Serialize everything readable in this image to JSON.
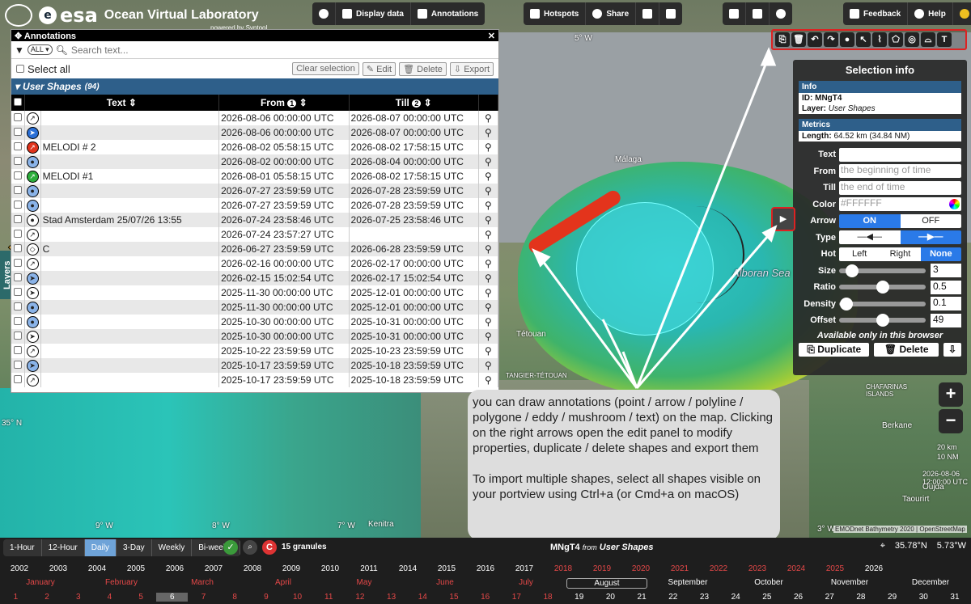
{
  "topbar": {
    "brand": "esa",
    "title": "Ocean Virtual Laboratory",
    "powered": "powered by Syntool",
    "display_data": "Display data",
    "annotations": "Annotations",
    "hotspots": "Hotspots",
    "share": "Share",
    "feedback": "Feedback",
    "help": "Help"
  },
  "annotations_panel": {
    "title": "Annotations",
    "filter": "ALL",
    "search_placeholder": "Search text...",
    "select_all": "Select all",
    "clear_selection": "Clear selection",
    "edit": "Edit",
    "delete": "Delete",
    "export": "Export",
    "group_name": "User Shapes",
    "group_count": "(94)",
    "columns": {
      "text": "Text",
      "from": "From",
      "till": "Till",
      "from_sort": "1",
      "till_sort": "2"
    },
    "rows": [
      {
        "icon": "polyline-icon",
        "style": "",
        "text": "",
        "from": "2026-08-06 00:00:00 UTC",
        "till": "2026-08-07 00:00:00 UTC"
      },
      {
        "icon": "arrow-icon",
        "style": "blue",
        "text": "",
        "from": "2026-08-06 00:00:00 UTC",
        "till": "2026-08-07 00:00:00 UTC"
      },
      {
        "icon": "polyline-icon",
        "style": "red",
        "text": "MELODI # 2",
        "from": "2026-08-02 05:58:15 UTC",
        "till": "2026-08-02 17:58:15 UTC"
      },
      {
        "icon": "point-icon",
        "style": "lblue",
        "text": "",
        "from": "2026-08-02 00:00:00 UTC",
        "till": "2026-08-04 00:00:00 UTC"
      },
      {
        "icon": "polyline-icon",
        "style": "green",
        "text": "MELODI #1",
        "from": "2026-08-01 05:58:15 UTC",
        "till": "2026-08-02 17:58:15 UTC"
      },
      {
        "icon": "point-icon",
        "style": "lblue",
        "text": "",
        "from": "2026-07-27 23:59:59 UTC",
        "till": "2026-07-28 23:59:59 UTC"
      },
      {
        "icon": "point-icon",
        "style": "lblue",
        "text": "",
        "from": "2026-07-27 23:59:59 UTC",
        "till": "2026-07-28 23:59:59 UTC"
      },
      {
        "icon": "point-icon",
        "style": "",
        "text": "Stad Amsterdam 25/07/26 13:55",
        "from": "2026-07-24 23:58:46 UTC",
        "till": "2026-07-25 23:58:46 UTC"
      },
      {
        "icon": "polyline-icon",
        "style": "",
        "text": "",
        "from": "2026-07-24 23:57:27 UTC",
        "till": ""
      },
      {
        "icon": "polygon-icon",
        "style": "",
        "text": "C",
        "from": "2026-06-27 23:59:59 UTC",
        "till": "2026-06-28 23:59:59 UTC"
      },
      {
        "icon": "polyline-icon",
        "style": "",
        "text": "",
        "from": "2026-02-16 00:00:00 UTC",
        "till": "2026-02-17 00:00:00 UTC"
      },
      {
        "icon": "arrow-icon",
        "style": "lblue",
        "text": "",
        "from": "2026-02-15 15:02:54 UTC",
        "till": "2026-02-17 15:02:54 UTC"
      },
      {
        "icon": "arrow-icon",
        "style": "",
        "text": "",
        "from": "2025-11-30 00:00:00 UTC",
        "till": "2025-12-01 00:00:00 UTC"
      },
      {
        "icon": "point-icon",
        "style": "lblue",
        "text": "",
        "from": "2025-11-30 00:00:00 UTC",
        "till": "2025-12-01 00:00:00 UTC"
      },
      {
        "icon": "point-icon",
        "style": "lblue",
        "text": "",
        "from": "2025-10-30 00:00:00 UTC",
        "till": "2025-10-31 00:00:00 UTC"
      },
      {
        "icon": "arrow-icon",
        "style": "",
        "text": "",
        "from": "2025-10-30 00:00:00 UTC",
        "till": "2025-10-31 00:00:00 UTC"
      },
      {
        "icon": "polyline-icon",
        "style": "",
        "text": "",
        "from": "2025-10-22 23:59:59 UTC",
        "till": "2025-10-23 23:59:59 UTC"
      },
      {
        "icon": "arrow-icon",
        "style": "lblue",
        "text": "",
        "from": "2025-10-17 23:59:59 UTC",
        "till": "2025-10-18 23:59:59 UTC"
      },
      {
        "icon": "polyline-icon",
        "style": "",
        "text": "",
        "from": "2025-10-17 23:59:59 UTC",
        "till": "2025-10-18 23:59:59 UTC"
      }
    ]
  },
  "layers_tab": "Layers",
  "selection_info": {
    "title": "Selection info",
    "info_header": "Info",
    "id_label": "ID:",
    "id_value": "MNgT4",
    "layer_label": "Layer:",
    "layer_value": "User Shapes",
    "metrics_header": "Metrics",
    "length_label": "Length:",
    "length_value": "64.52 km (34.84 NM)",
    "text_label": "Text",
    "from_label": "From",
    "from_placeholder": "the beginning of time",
    "till_label": "Till",
    "till_placeholder": "the end of time",
    "color_label": "Color",
    "color_value": "#FFFFFF",
    "arrow_label": "Arrow",
    "arrow_on": "ON",
    "arrow_off": "OFF",
    "type_label": "Type",
    "hot_label": "Hot",
    "hot_left": "Left",
    "hot_right": "Right",
    "hot_none": "None",
    "size_label": "Size",
    "size_value": "3",
    "ratio_label": "Ratio",
    "ratio_value": "0.5",
    "density_label": "Density",
    "density_value": "0.1",
    "offset_label": "Offset",
    "offset_value": "49",
    "note": "Available only in this browser",
    "duplicate": "Duplicate",
    "delete": "Delete",
    "slider_positions": {
      "size": 0.15,
      "ratio": 0.5,
      "density": 0.08,
      "offset": 0.5
    }
  },
  "map": {
    "labels": {
      "malaga": "Málaga",
      "alboran": "Alboran Sea",
      "tetouan": "Tétouan",
      "tangier": "TANGIER-TÉTOUAN",
      "kenitra": "Kenitra",
      "berkane": "Berkane",
      "oujda": "Oujda",
      "taourirt": "Taourirt",
      "chafarinas": "CHAFARINAS ISLANDS",
      "lon5w": "5° W",
      "lon9w": "9° W",
      "lon8w": "8° W",
      "lon7w": "7° W",
      "lon3w": "3° W",
      "lat35n": "35° N",
      "attrib": "EMODnet Bathymetry 2020 | OpenStreetMap",
      "scale_km": "20 km",
      "scale_nm": "10 NM",
      "map_date": "2026-08-06 12:00:00 UTC"
    }
  },
  "callout": {
    "para1": "you can draw annotations (point / arrow / polyline / polygone / eddy / mushroom / text) on the map. Clicking on the right arrows open the edit panel to modify properties, duplicate / delete shapes and export them",
    "para2": "To import multiple shapes, select all shapes visible on your portview using Ctrl+a (or Cmd+a on macOS)"
  },
  "bottom": {
    "periods": [
      "1-Hour",
      "12-Hour",
      "Daily",
      "3-Day",
      "Weekly",
      "Bi-weekly"
    ],
    "active_period": "Daily",
    "granules": "15 granules",
    "selected_id": "MNgT4",
    "selected_from": "from",
    "selected_layer": "User Shapes",
    "lat": "35.78°N",
    "lon": "5.73°W",
    "years": [
      "2002",
      "2003",
      "2004",
      "2005",
      "2006",
      "2007",
      "2008",
      "2009",
      "2010",
      "2011",
      "2014",
      "2015",
      "2016",
      "2017",
      "2018",
      "2019",
      "2020",
      "2021",
      "2022",
      "2023",
      "2024",
      "2025",
      "2026"
    ],
    "months": [
      "January",
      "February",
      "March",
      "April",
      "May",
      "June",
      "July",
      "August",
      "September",
      "October",
      "November",
      "December"
    ],
    "days": [
      "1",
      "2",
      "3",
      "4",
      "5",
      "6",
      "7",
      "8",
      "9",
      "10",
      "11",
      "12",
      "13",
      "14",
      "15",
      "16",
      "17",
      "18",
      "19",
      "20",
      "21",
      "22",
      "23",
      "24",
      "25",
      "26",
      "27",
      "28",
      "29",
      "30",
      "31"
    ]
  },
  "colors": {
    "accent_blue": "#2a7ae8",
    "highlight_red": "#dd2222",
    "group_blue": "#2e5f8a"
  }
}
